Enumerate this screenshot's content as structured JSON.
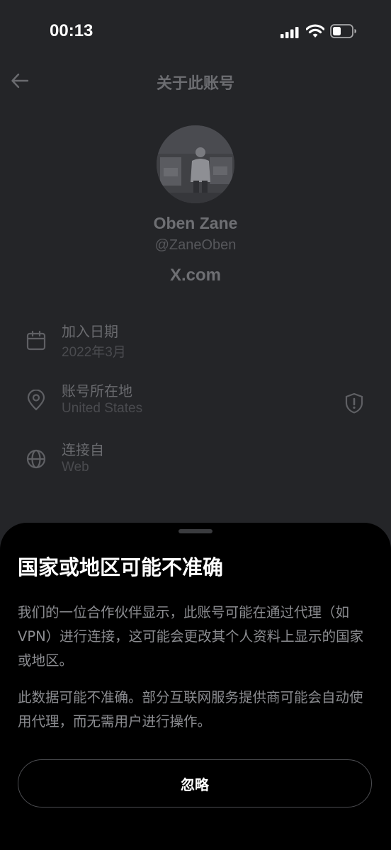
{
  "status_bar": {
    "time": "00:13"
  },
  "header": {
    "title": "关于此账号"
  },
  "profile": {
    "name": "Oben Zane",
    "handle": "@ZaneOben",
    "domain": "X.com"
  },
  "info": {
    "joined": {
      "label": "加入日期",
      "value": "2022年3月",
      "icon": "calendar-icon"
    },
    "location": {
      "label": "账号所在地",
      "value": "United States",
      "icon": "location-pin-icon",
      "badge_icon": "shield-alert-icon"
    },
    "connected": {
      "label": "连接自",
      "value": "Web",
      "icon": "globe-icon"
    }
  },
  "sheet": {
    "title": "国家或地区可能不准确",
    "paragraph1": "我们的一位合作伙伴显示，此账号可能在通过代理（如 VPN）进行连接，这可能会更改其个人资料上显示的国家或地区。",
    "paragraph2": "此数据可能不准确。部分互联网服务提供商可能会自动使用代理，而无需用户进行操作。",
    "ignore_label": "忽略"
  },
  "colors": {
    "background": "#242528",
    "sheet_background": "#000000",
    "dim_text": "#6a6b6f"
  }
}
